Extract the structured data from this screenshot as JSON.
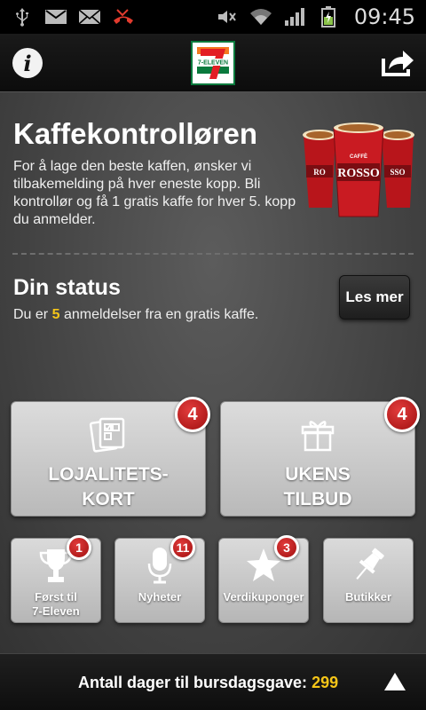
{
  "status_bar": {
    "time": "09:45",
    "left_icons": [
      "usb-icon",
      "gmail-icon",
      "email-icon",
      "missed-call-icon"
    ],
    "right_icons": [
      "mute-icon",
      "wifi-icon",
      "signal-icon",
      "battery-icon"
    ]
  },
  "top_bar": {
    "info_icon": "info-icon",
    "logo_text": "7-ELEVEN",
    "share_icon": "share-icon"
  },
  "intro": {
    "title": "Kaffekontrolløren",
    "description": "For å lage den beste kaffen, ønsker vi tilbakemelding på hver eneste kopp. Bli kontrollør og få 1 gratis kaffe for hver 5. kopp du anmelder.",
    "cup_brand": "CAFFÈ ROSSO"
  },
  "status": {
    "title": "Din status",
    "text_before": "Du er",
    "count": "5",
    "text_after": "anmeldelser fra en gratis kaffe.",
    "read_more": "Les mer"
  },
  "big_tiles": [
    {
      "line1": "LOJALITETS-",
      "line2": "KORT",
      "badge": "4",
      "icon": "loyalty-card-icon"
    },
    {
      "line1": "UKENS",
      "line2": "TILBUD",
      "badge": "4",
      "icon": "gift-icon"
    }
  ],
  "small_tiles": [
    {
      "line1": "Først til",
      "line2": "7-Eleven",
      "badge": "1",
      "icon": "trophy-icon"
    },
    {
      "line1": "Nyheter",
      "line2": "",
      "badge": "11",
      "icon": "microphone-icon"
    },
    {
      "line1": "Verdikuponger",
      "line2": "",
      "badge": "3",
      "icon": "star-icon"
    },
    {
      "line1": "Butikker",
      "line2": "",
      "badge": "",
      "icon": "pin-icon"
    }
  ],
  "bottom_bar": {
    "label": "Antall dager til bursdagsgave:",
    "days": "299",
    "up_icon": "arrow-up-icon"
  },
  "colors": {
    "accent_yellow": "#f5c518",
    "badge_red": "#c41a1a",
    "brand_green": "#0a7a3d",
    "brand_orange": "#f47920"
  }
}
